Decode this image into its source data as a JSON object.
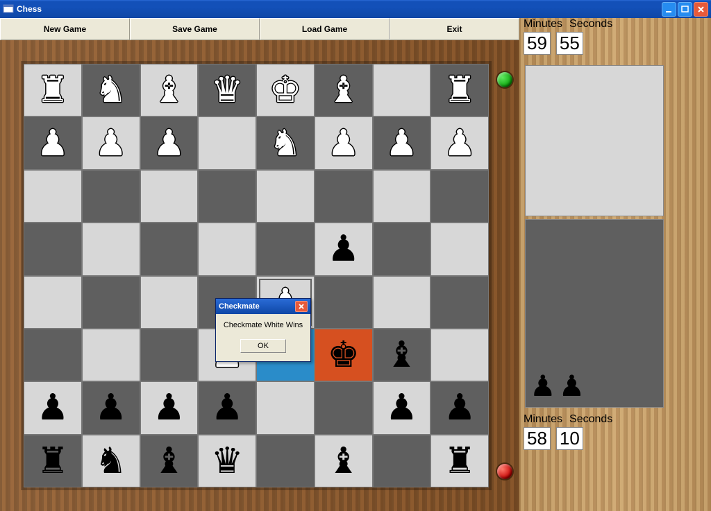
{
  "window": {
    "title": "Chess"
  },
  "toolbar": {
    "new_game": "New Game",
    "save_game": "Save Game",
    "load_game": "Load Game",
    "exit": "Exit"
  },
  "clock": {
    "minutes_label": "Minutes",
    "seconds_label": "Seconds",
    "top": {
      "minutes": "59",
      "seconds": "55"
    },
    "bottom": {
      "minutes": "58",
      "seconds": "10"
    }
  },
  "dialog": {
    "title": "Checkmate",
    "message": "Checkmate White Wins",
    "ok": "OK"
  },
  "captured": {
    "top": [],
    "bottom": [
      "♟",
      "♟"
    ]
  },
  "board": {
    "highlights": [
      {
        "row": 4,
        "col": 4,
        "type": "inner"
      },
      {
        "row": 5,
        "col": 4,
        "type": "blue"
      },
      {
        "row": 5,
        "col": 5,
        "type": "orange"
      }
    ],
    "rows": [
      [
        {
          "p": "♜",
          "c": "w"
        },
        {
          "p": "♞",
          "c": "w"
        },
        {
          "p": "♝",
          "c": "w"
        },
        {
          "p": "♛",
          "c": "w"
        },
        {
          "p": "♚",
          "c": "w"
        },
        {
          "p": "♝",
          "c": "w"
        },
        {
          "p": "",
          "c": ""
        },
        {
          "p": "♜",
          "c": "w"
        }
      ],
      [
        {
          "p": "♟",
          "c": "w"
        },
        {
          "p": "♟",
          "c": "w"
        },
        {
          "p": "♟",
          "c": "w"
        },
        {
          "p": "",
          "c": ""
        },
        {
          "p": "♞",
          "c": "w"
        },
        {
          "p": "♟",
          "c": "w"
        },
        {
          "p": "♟",
          "c": "w"
        },
        {
          "p": "♟",
          "c": "w"
        }
      ],
      [
        {
          "p": "",
          "c": ""
        },
        {
          "p": "",
          "c": ""
        },
        {
          "p": "",
          "c": ""
        },
        {
          "p": "",
          "c": ""
        },
        {
          "p": "",
          "c": ""
        },
        {
          "p": "",
          "c": ""
        },
        {
          "p": "",
          "c": ""
        },
        {
          "p": "",
          "c": ""
        }
      ],
      [
        {
          "p": "",
          "c": ""
        },
        {
          "p": "",
          "c": ""
        },
        {
          "p": "",
          "c": ""
        },
        {
          "p": "",
          "c": ""
        },
        {
          "p": "",
          "c": ""
        },
        {
          "p": "♟",
          "c": "b"
        },
        {
          "p": "",
          "c": ""
        },
        {
          "p": "",
          "c": ""
        }
      ],
      [
        {
          "p": "",
          "c": ""
        },
        {
          "p": "",
          "c": ""
        },
        {
          "p": "",
          "c": ""
        },
        {
          "p": "",
          "c": ""
        },
        {
          "p": "♟",
          "c": "w"
        },
        {
          "p": "",
          "c": ""
        },
        {
          "p": "",
          "c": ""
        },
        {
          "p": "",
          "c": ""
        }
      ],
      [
        {
          "p": "",
          "c": ""
        },
        {
          "p": "",
          "c": ""
        },
        {
          "p": "",
          "c": ""
        },
        {
          "p": "♟",
          "c": "w"
        },
        {
          "p": "",
          "c": ""
        },
        {
          "p": "♚",
          "c": "b"
        },
        {
          "p": "♝",
          "c": "b"
        },
        {
          "p": "",
          "c": ""
        }
      ],
      [
        {
          "p": "♟",
          "c": "b"
        },
        {
          "p": "♟",
          "c": "b"
        },
        {
          "p": "♟",
          "c": "b"
        },
        {
          "p": "♟",
          "c": "b"
        },
        {
          "p": "",
          "c": ""
        },
        {
          "p": "",
          "c": ""
        },
        {
          "p": "♟",
          "c": "b"
        },
        {
          "p": "♟",
          "c": "b"
        }
      ],
      [
        {
          "p": "♜",
          "c": "b"
        },
        {
          "p": "♞",
          "c": "b"
        },
        {
          "p": "♝",
          "c": "b"
        },
        {
          "p": "♛",
          "c": "b"
        },
        {
          "p": "",
          "c": ""
        },
        {
          "p": "♝",
          "c": "b"
        },
        {
          "p": "",
          "c": ""
        },
        {
          "p": "♜",
          "c": "b"
        }
      ]
    ]
  }
}
